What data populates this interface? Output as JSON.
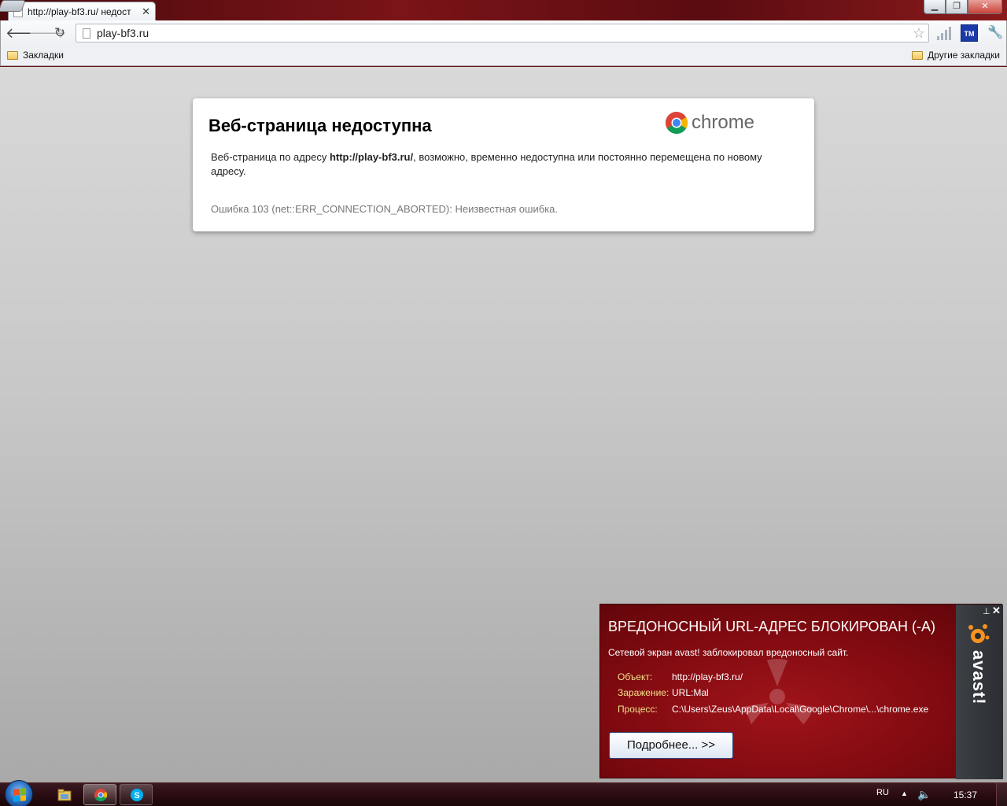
{
  "browser": {
    "tab_title": "http://play-bf3.ru/ недост",
    "tab_close": "✕",
    "url": "play-bf3.ru",
    "bookmarks_left": "Закладки",
    "bookmarks_right": "Другие закладки",
    "ext_tm_label": "TM"
  },
  "error_page": {
    "title": "Веб-страница недоступна",
    "logo_text": "chrome",
    "desc_prefix": "Веб-страница по адресу ",
    "desc_url": "http://play-bf3.ru/",
    "desc_suffix": ", возможно, временно недоступна или постоянно перемещена по новому адресу.",
    "error_code": "Ошибка 103 (net::ERR_CONNECTION_ABORTED): Неизвестная ошибка."
  },
  "avast": {
    "title": "ВРЕДОНОСНЫЙ URL-АДРЕС БЛОКИРОВАН (-A)",
    "subtitle": "Сетевой экран avast! заблокировал вредоносный сайт.",
    "rows": [
      {
        "label": "Объект:",
        "value": "http://play-bf3.ru/"
      },
      {
        "label": "Заражение:",
        "value": "URL:Mal"
      },
      {
        "label": "Процесс:",
        "value": "C:\\Users\\Zeus\\AppData\\Local\\Google\\Chrome\\...\\chrome.exe"
      }
    ],
    "more_button": "Подробнее... >>",
    "brand": "avast!"
  },
  "taskbar": {
    "lang": "RU",
    "clock": "15:37"
  }
}
